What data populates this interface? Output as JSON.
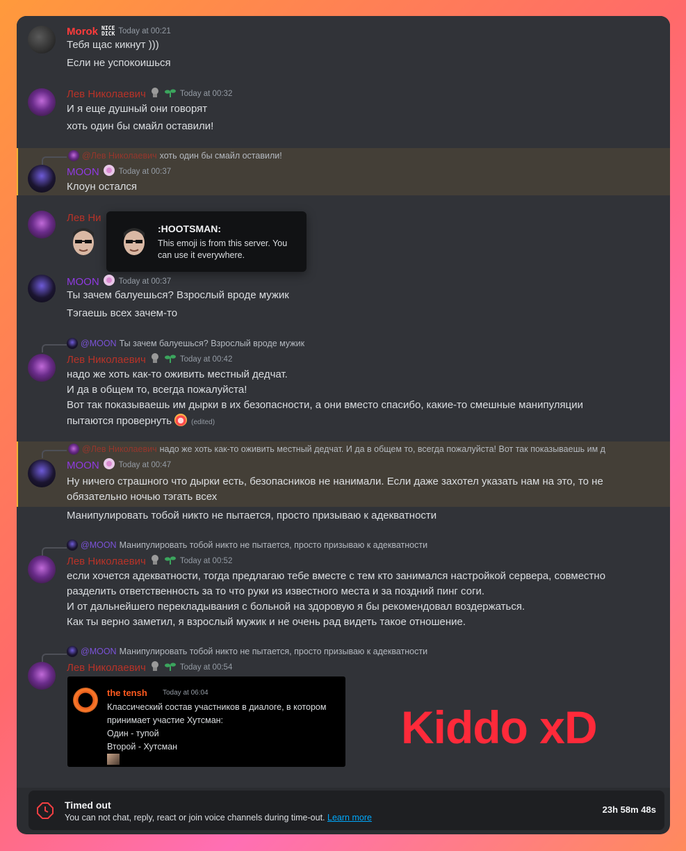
{
  "messages": {
    "m1": {
      "author": "Morok",
      "time": "Today at 00:21",
      "lines": [
        "Тебя щас кикнут )))",
        "Если не успокоишься"
      ]
    },
    "m2": {
      "author": "Лев Николаевич",
      "time": "Today at 00:32",
      "lines": [
        "И я еще душный они говорят",
        "хоть один бы смайл оставили!"
      ]
    },
    "m3": {
      "reply_mention": "@Лев Николаевич",
      "reply_text": "хоть один бы смайл оставили!",
      "author": "MOON",
      "time": "Today at 00:37",
      "lines": [
        "Клоун остался"
      ]
    },
    "m4": {
      "author": "Лев Ни"
    },
    "m5": {
      "author": "MOON",
      "time": "Today at 00:37",
      "lines": [
        "Ты зачем балуешься? Взрослый вроде мужик",
        "Тэгаешь всех зачем-то"
      ]
    },
    "m6": {
      "reply_mention": "@MOON",
      "reply_text": "Ты зачем балуешься? Взрослый вроде мужик",
      "author": "Лев Николаевич",
      "time": "Today at 00:42",
      "lines": [
        "надо же хоть как-то оживить местный дедчат.",
        "И да в общем то, всегда пожалуйста!",
        "Вот так показываешь им дырки в их безопасности, а они вместо спасибо, какие-то смешные манипуляции",
        "пытаются провернуть"
      ],
      "edited": "(edited)"
    },
    "m7": {
      "reply_mention": "@Лев Николаевич",
      "reply_text": "надо же хоть как-то оживить местный дедчат. И да в общем то, всегда пожалуйста! Вот так показываешь им д",
      "author": "MOON",
      "time": "Today at 00:47",
      "lines": [
        "Ну ничего страшного что дырки есть, безопасников не нанимали. Если даже захотел указать нам на это, то не",
        "обязательно ночью тэгать всех",
        "Манипулировать тобой никто не пытается, просто призываю к адекватности"
      ]
    },
    "m8": {
      "reply_mention": "@MOON",
      "reply_text": "Манипулировать тобой никто не пытается, просто призываю к адекватности",
      "author": "Лев Николаевич",
      "time": "Today at 00:52",
      "lines": [
        "если хочется адекватности, тогда предлагаю тебе вместе с тем кто занимался настройкой сервера, совместно",
        "разделить ответственность за то что руки из известного места и за поздний пинг соги.",
        "И от дальнейшего перекладывания с больной на здоровую я бы рекомендовал воздержаться.",
        "Как ты верно заметил, я взрослый мужик и не очень рад видеть такое отношение."
      ]
    },
    "m9": {
      "reply_mention": "@MOON",
      "reply_text": "Манипулировать тобой никто не пытается, просто призываю к адекватности",
      "author": "Лев Николаевич",
      "time": "Today at 00:54",
      "embed": {
        "author": "the tensh",
        "time": "Today at 06:04",
        "lines": [
          "Классический состав участников в диалоге, в котором",
          "принимает участие Хутсман:",
          "Один - тупой",
          "Второй - Хутсман"
        ]
      }
    }
  },
  "tooltip": {
    "title": ":HOOTSMAN:",
    "body": "This emoji is from this server. You can use it everywhere."
  },
  "overlay_text": "Kiddo xD",
  "morok_badge": [
    "NICE",
    "DICK"
  ],
  "timeout": {
    "title": "Timed out",
    "desc": "You can not chat, reply, react or join voice channels during time-out.",
    "link": "Learn more",
    "timer": "23h 58m 48s"
  },
  "colors": {
    "bg": "#313338",
    "lev": "#b83328",
    "moon": "#8f3ae0",
    "morok": "#ff3b3b",
    "accent_text": "#ff2a3a"
  }
}
